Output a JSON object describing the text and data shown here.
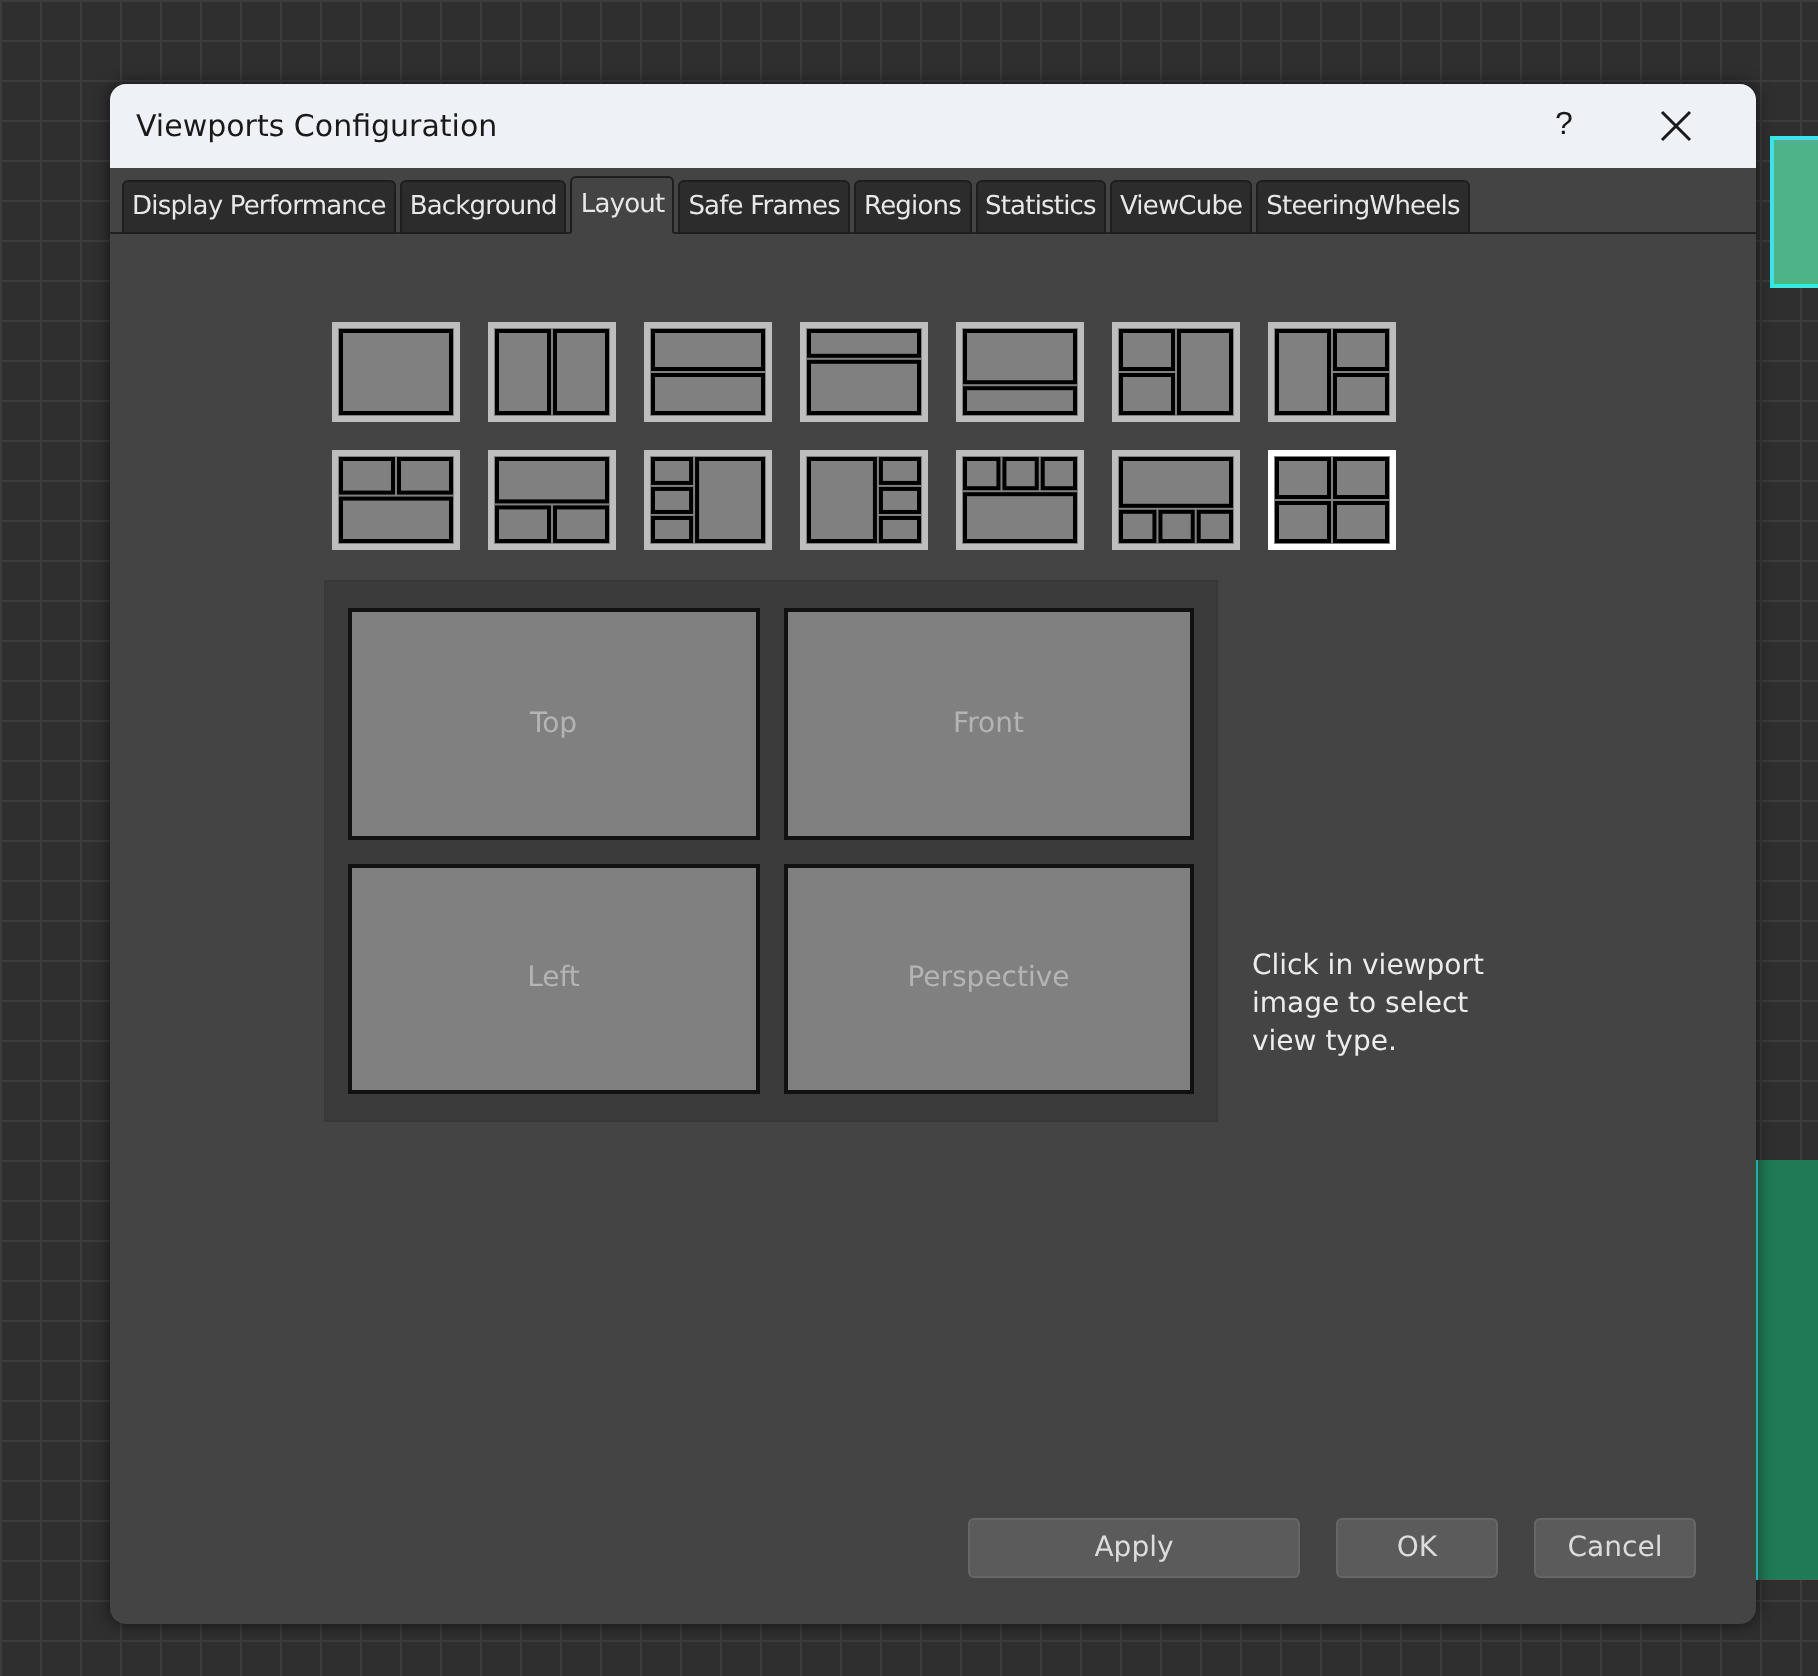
{
  "window": {
    "title": "Viewports Configuration",
    "help": "?"
  },
  "tabs": [
    {
      "label": "Display Performance",
      "selected": false
    },
    {
      "label": "Background",
      "selected": false
    },
    {
      "label": "Layout",
      "selected": true
    },
    {
      "label": "Safe Frames",
      "selected": false
    },
    {
      "label": "Regions",
      "selected": false
    },
    {
      "label": "Statistics",
      "selected": false
    },
    {
      "label": "ViewCube",
      "selected": false
    },
    {
      "label": "SteeringWheels",
      "selected": false
    }
  ],
  "layouts": [
    {
      "kind": "single",
      "selected": false
    },
    {
      "kind": "vsplit",
      "selected": false
    },
    {
      "kind": "hsplit",
      "selected": false
    },
    {
      "kind": "topsmall",
      "selected": false
    },
    {
      "kind": "bottomsmall",
      "selected": false
    },
    {
      "kind": "leftpair",
      "selected": false
    },
    {
      "kind": "rightpair",
      "selected": false
    },
    {
      "kind": "toppair",
      "selected": false
    },
    {
      "kind": "bottompair",
      "selected": false
    },
    {
      "kind": "leftthree",
      "selected": false
    },
    {
      "kind": "rightthree",
      "selected": false
    },
    {
      "kind": "topthree",
      "selected": false
    },
    {
      "kind": "bottomthree",
      "selected": false
    },
    {
      "kind": "quad",
      "selected": true
    }
  ],
  "viewports": [
    {
      "label": "Top"
    },
    {
      "label": "Front"
    },
    {
      "label": "Left"
    },
    {
      "label": "Perspective"
    }
  ],
  "hint": "Click in viewport image to select view type.",
  "buttons": [
    {
      "label": "Apply",
      "kind": "wide"
    },
    {
      "label": "OK",
      "kind": "normal"
    },
    {
      "label": "Cancel",
      "kind": "normal"
    }
  ]
}
